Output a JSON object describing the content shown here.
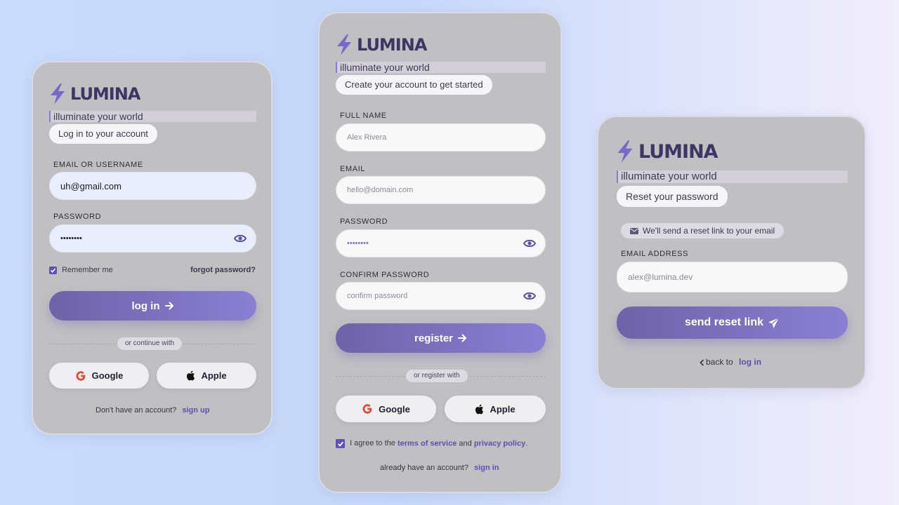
{
  "brand": {
    "name": "LUMINA",
    "tagline": "illuminate your world"
  },
  "colors": {
    "accent": "#6e62a8",
    "accent_light": "#8a7fd3",
    "link": "#5e4fb0",
    "card": "#c0c0c3"
  },
  "login": {
    "subtitle": "Log in to your account",
    "email_label": "EMAIL OR USERNAME",
    "email_value": "uh@gmail.com",
    "password_label": "PASSWORD",
    "password_value": "••••••••",
    "remember_label": "Remember me",
    "remember_checked": true,
    "forgot_link": "forgot password?",
    "submit_label": "log in",
    "divider_text": "or continue with",
    "google_label": "Google",
    "apple_label": "Apple",
    "footer_text": "Don't have an account?",
    "footer_link": "sign up"
  },
  "register": {
    "subtitle": "Create your account to get started",
    "fullname_label": "FULL NAME",
    "fullname_placeholder": "Alex Rivera",
    "email_label": "EMAIL",
    "email_placeholder": "hello@domain.com",
    "password_label": "PASSWORD",
    "password_value": "••••••••",
    "confirm_label": "CONFIRM PASSWORD",
    "confirm_placeholder": "confirm password",
    "submit_label": "register",
    "divider_text": "or register with",
    "google_label": "Google",
    "apple_label": "Apple",
    "terms_prefix": "I agree to the",
    "terms_link": "terms of service",
    "terms_and": "and",
    "privacy_link": "privacy policy",
    "terms_suffix": ".",
    "footer_text": "already have an account?",
    "footer_link": "sign in"
  },
  "reset": {
    "subtitle": "Reset your password",
    "info_text": "We'll send a reset link to your email",
    "email_label": "EMAIL ADDRESS",
    "email_placeholder": "alex@lumina.dev",
    "submit_label": "send reset link",
    "back_text": "back to",
    "back_link": "log in"
  }
}
